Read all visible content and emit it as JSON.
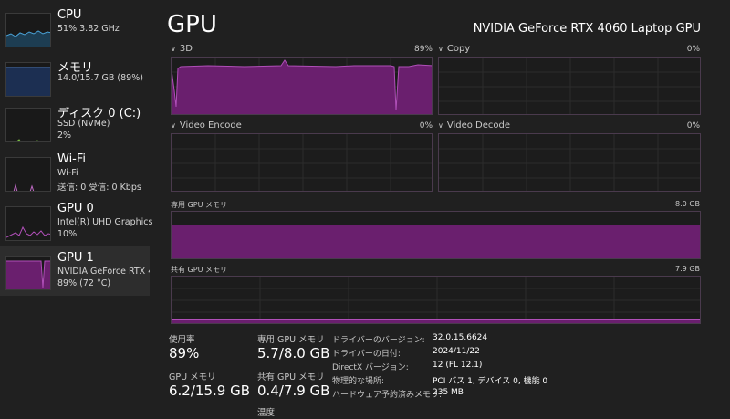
{
  "colors": {
    "gpu_fill": "#6a1f6e",
    "gpu_line": "#b04fb8",
    "cpu_line": "#4aa3d8",
    "mem_line": "#4a7fd0",
    "disk_line": "#7bc142",
    "wifi_line": "#c06ac6"
  },
  "sidebar": {
    "items": [
      {
        "name": "CPU",
        "sub1": "51%  3.82 GHz",
        "sub2": "",
        "icon": "cpu-graph"
      },
      {
        "name": "メモリ",
        "sub1": "14.0/15.7 GB (89%)",
        "sub2": "",
        "icon": "memory-graph"
      },
      {
        "name": "ディスク 0 (C:)",
        "sub1": "SSD (NVMe)",
        "sub2": "2%",
        "icon": "disk-graph"
      },
      {
        "name": "Wi-Fi",
        "sub1": "Wi-Fi",
        "sub2": "送信: 0 受信: 0 Kbps",
        "icon": "wifi-graph"
      },
      {
        "name": "GPU 0",
        "sub1": "Intel(R) UHD Graphics",
        "sub2": "10%",
        "icon": "gpu0-graph"
      },
      {
        "name": "GPU 1",
        "sub1": "NVIDIA GeForce RTX 40",
        "sub2": "89% (72 °C)",
        "icon": "gpu1-graph"
      }
    ]
  },
  "main": {
    "title": "GPU",
    "model": "NVIDIA GeForce RTX 4060 Laptop GPU",
    "engines": [
      {
        "label": "3D",
        "percent": "89%",
        "utilization": 0.89
      },
      {
        "label": "Copy",
        "percent": "0%",
        "utilization": 0
      },
      {
        "label": "Video Encode",
        "percent": "0%",
        "utilization": 0
      },
      {
        "label": "Video Decode",
        "percent": "0%",
        "utilization": 0
      }
    ],
    "dedicated_memory": {
      "label": "専用 GPU メモリ",
      "max": "8.0 GB",
      "usage": 0.71
    },
    "shared_memory": {
      "label": "共有 GPU メモリ",
      "max": "7.9 GB",
      "usage": 0.05
    }
  },
  "stats": {
    "utilization": {
      "label": "使用率",
      "value": "89%"
    },
    "gpu_memory": {
      "label": "GPU メモリ",
      "value": "6.2/15.9 GB"
    },
    "dedicated": {
      "label": "専用 GPU メモリ",
      "value": "5.7/8.0 GB"
    },
    "shared": {
      "label": "共有 GPU メモリ",
      "value": "0.4/7.9 GB"
    },
    "temperature": {
      "label": "温度"
    }
  },
  "info": [
    {
      "label": "ドライバーのバージョン:",
      "value": "32.0.15.6624"
    },
    {
      "label": "ドライバーの日付:",
      "value": "2024/11/22"
    },
    {
      "label": "DirectX バージョン:",
      "value": "12 (FL 12.1)"
    },
    {
      "label": "物理的な場所:",
      "value": "PCI バス 1, デバイス 0, 機能 0"
    },
    {
      "label": "ハードウェア予約済みメモリ:",
      "value": "235 MB"
    }
  ]
}
